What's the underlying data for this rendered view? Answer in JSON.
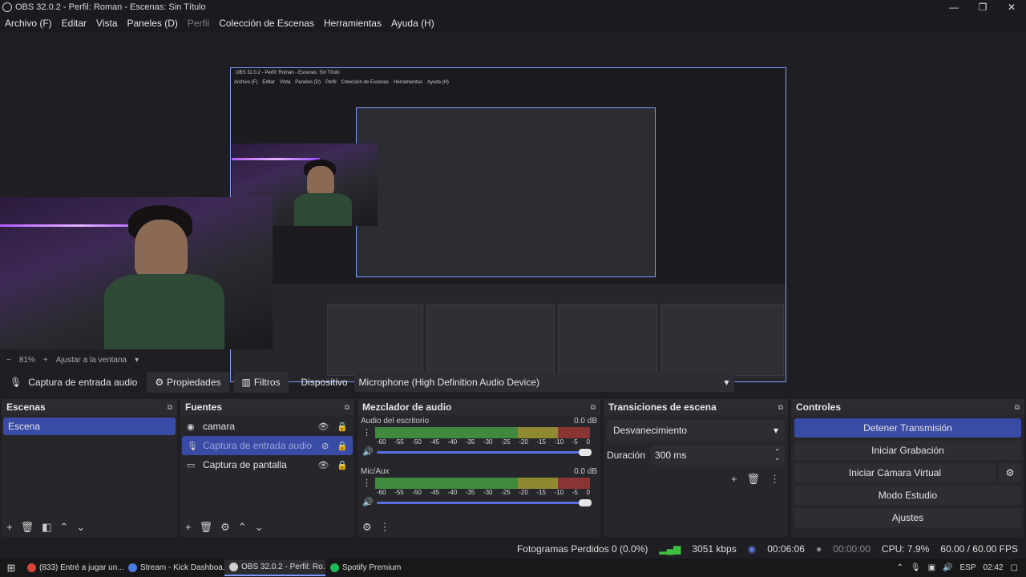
{
  "window": {
    "title": "OBS 32.0.2 - Perfil: Roman - Escenas: Sin Título",
    "minimize": "—",
    "maximize": "❐",
    "close": "✕"
  },
  "menu": {
    "items": [
      "Archivo (F)",
      "Editar",
      "Vista",
      "Paneles (D)",
      "Perfil",
      "Colección de Escenas",
      "Herramientas",
      "Ayuda (H)"
    ]
  },
  "nested": {
    "title": "OBS 32.0.2 - Perfil: Roman - Escenas: Sin Título",
    "menu": [
      "Archivo (F)",
      "Editar",
      "Vista",
      "Paneles (D)",
      "Perfil",
      "Colección de Escenas",
      "Herramientas",
      "Ayuda (H)"
    ]
  },
  "zoom": {
    "minus": "−",
    "value": "81%",
    "plus": "+",
    "fit_label": "Ajustar a la ventana",
    "chevron": "▾"
  },
  "source_toolbar": {
    "source_name": "Captura de entrada audio",
    "properties": "Propiedades",
    "filters": "Filtros",
    "device_label": "Dispositivo",
    "device_value": "Microphone (High Definition Audio Device)",
    "chevron": "▾"
  },
  "scenes": {
    "title": "Escenas",
    "items": [
      "Escena"
    ],
    "selected": "Escena"
  },
  "sources": {
    "title": "Fuentes",
    "items": [
      {
        "name": "camara",
        "icon": "camera-icon",
        "visible": true,
        "locked": true
      },
      {
        "name": "Captura de entrada audio",
        "icon": "mic-icon",
        "visible": false,
        "locked": true
      },
      {
        "name": "Captura de pantalla",
        "icon": "monitor-icon",
        "visible": true,
        "locked": true
      }
    ]
  },
  "mixer": {
    "title": "Mezclador de audio",
    "channels": [
      {
        "name": "Audio del escritorio",
        "level": "0.0 dB",
        "volume": 1.0
      },
      {
        "name": "Mic/Aux",
        "level": "0.0 dB",
        "volume": 1.0
      }
    ],
    "ticks": [
      "-60",
      "-55",
      "-50",
      "-45",
      "-40",
      "-35",
      "-30",
      "-25",
      "-20",
      "-15",
      "-10",
      "-5",
      "0"
    ]
  },
  "transitions": {
    "title": "Transiciones de escena",
    "selected": "Desvanecimiento",
    "duration_label": "Duración",
    "duration_value": "300 ms"
  },
  "controls": {
    "title": "Controles",
    "buttons": [
      "Detener Transmisión",
      "Iniciar Grabación",
      "Iniciar Cámara Virtual",
      "Modo Estudio",
      "Ajustes"
    ]
  },
  "status": {
    "dropped": "Fotogramas Perdidos 0 (0.0%)",
    "bitrate": "3051 kbps",
    "stream_time": "00:06:06",
    "rec_time": "00:00:00",
    "cpu": "CPU: 7.9%",
    "fps": "60.00 / 60.00 FPS"
  },
  "taskbar": {
    "items": [
      {
        "label": "(833) Entré a jugar un...",
        "color": "#d6463a"
      },
      {
        "label": "Stream - Kick Dashboa...",
        "color": "#4a7be0"
      },
      {
        "label": "OBS 32.0.2 - Perfil: Ro...",
        "color": "#cfcfcf"
      },
      {
        "label": "Spotify Premium",
        "color": "#1db954"
      }
    ],
    "lang": "ESP",
    "time": "02:42"
  },
  "colors": {
    "accent": "#394ba5",
    "background": "#1f1f23",
    "dock": "#26262b"
  }
}
